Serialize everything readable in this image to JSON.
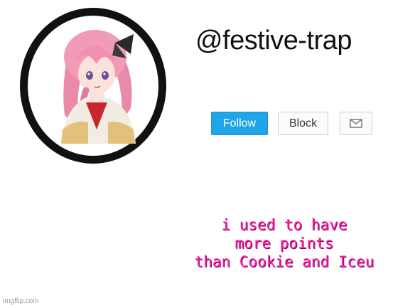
{
  "profile": {
    "username": "@festive-trap"
  },
  "actions": {
    "follow_label": "Follow",
    "block_label": "Block",
    "message_icon": "envelope-icon"
  },
  "caption": {
    "lines": [
      "i used to have",
      "more points",
      "than Cookie and Iceu"
    ]
  },
  "watermark": {
    "text": "imgflip.com"
  },
  "colors": {
    "follow_button": "#1fa6e8",
    "caption_text": "#ff1aa8",
    "avatar_ring": "#111111"
  }
}
